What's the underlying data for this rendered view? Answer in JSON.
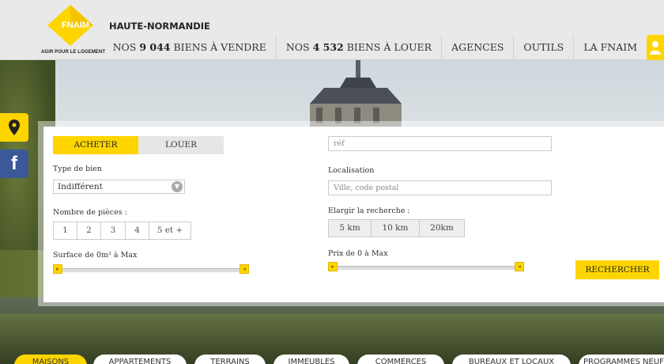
{
  "header": {
    "logo_text": "FNAIM",
    "logo_tagline": "AGIR POUR LE LOGEMENT",
    "region": "HAUTE-NORMANDIE",
    "nav": [
      {
        "prefix": "NOS ",
        "count": "9 044",
        "suffix": " BIENS À VENDRE"
      },
      {
        "prefix": "NOS ",
        "count": "4 532",
        "suffix": " BIENS À LOUER"
      },
      {
        "label": "AGENCES"
      },
      {
        "label": "OUTILS"
      },
      {
        "label": "LA FNAIM"
      }
    ],
    "user_icon": "user-icon"
  },
  "side": {
    "map_icon": "map-pin-icon",
    "facebook_label": "f"
  },
  "search": {
    "tabs": [
      {
        "label": "ACHETER",
        "active": true
      },
      {
        "label": "LOUER",
        "active": false
      }
    ],
    "type_label": "Type de bien",
    "type_value": "Indifférent",
    "rooms_label": "Nombre de pièces :",
    "rooms": [
      "1",
      "2",
      "3",
      "4",
      "5 et +"
    ],
    "surface_label": "Surface de 0m² à Max",
    "ref_placeholder": "réf",
    "location_label": "Localisation",
    "location_placeholder": "Ville, code postal",
    "widen_label": "Elargir la recherche :",
    "widen_options": [
      "5 km",
      "10 km",
      "20km"
    ],
    "price_label": "Prix de 0   à Max",
    "submit_label": "RECHERCHER"
  },
  "categories": [
    "MAISONS",
    "APPARTEMENTS",
    "TERRAINS",
    "IMMEUBLES",
    "COMMERCES",
    "BUREAUX ET LOCAUX",
    "PROGRAMMES NEUFS"
  ],
  "colors": {
    "accent": "#ffd500",
    "facebook": "#3b5998"
  }
}
